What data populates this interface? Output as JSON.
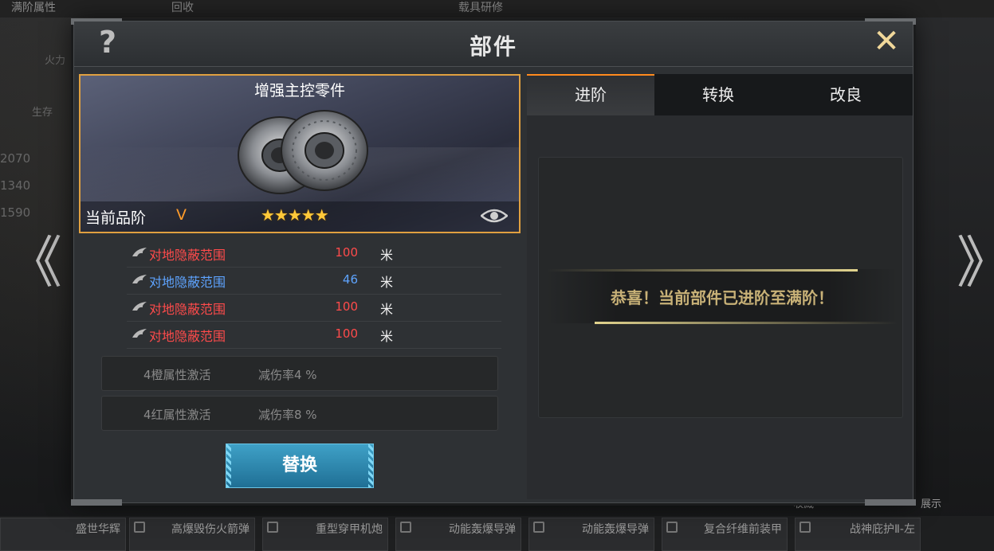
{
  "background": {
    "top_tabs": [
      "满阶属性",
      "回收",
      "载具研修"
    ],
    "left_labels": [
      "火力",
      "生存",
      "2070",
      "1340",
      "1590"
    ],
    "bottom_slots": [
      "盛世华辉",
      "高爆毁伤火箭弹",
      "重型穿甲机炮",
      "动能轰爆导弹",
      "动能轰爆导弹",
      "复合纤维前装甲",
      "战神庇护Ⅱ-左"
    ],
    "right_labels": [
      "收藏",
      "展示"
    ]
  },
  "dialog": {
    "title": "部件",
    "help_glyph": "?",
    "close_glyph": "✕"
  },
  "item": {
    "name": "增强主控零件",
    "quality_label": "当前品阶",
    "quality_grade": "V",
    "stars": "★★★★★",
    "star_count": 5
  },
  "attributes": [
    {
      "name": "对地隐蔽范围",
      "value": "100",
      "unit": "米",
      "color": "#ff4b4b"
    },
    {
      "name": "对地隐蔽范围",
      "value": "46",
      "unit": "米",
      "color": "#5ea4ff"
    },
    {
      "name": "对地隐蔽范围",
      "value": "100",
      "unit": "米",
      "color": "#ff4b4b"
    },
    {
      "name": "对地隐蔽范围",
      "value": "100",
      "unit": "米",
      "color": "#ff4b4b"
    }
  ],
  "set_bonuses": [
    {
      "label": "4橙属性激活",
      "effect": "减伤率4 %"
    },
    {
      "label": "4红属性激活",
      "effect": "减伤率8 %"
    }
  ],
  "replace_button": "替换",
  "tabs": [
    {
      "label": "进阶",
      "active": true
    },
    {
      "label": "转换",
      "active": false
    },
    {
      "label": "改良",
      "active": false
    }
  ],
  "message": "恭喜！当前部件已进阶至满阶！",
  "colors": {
    "accent": "#ff8a1e",
    "gold": "#c8b177",
    "button": "#2c8ab3"
  }
}
